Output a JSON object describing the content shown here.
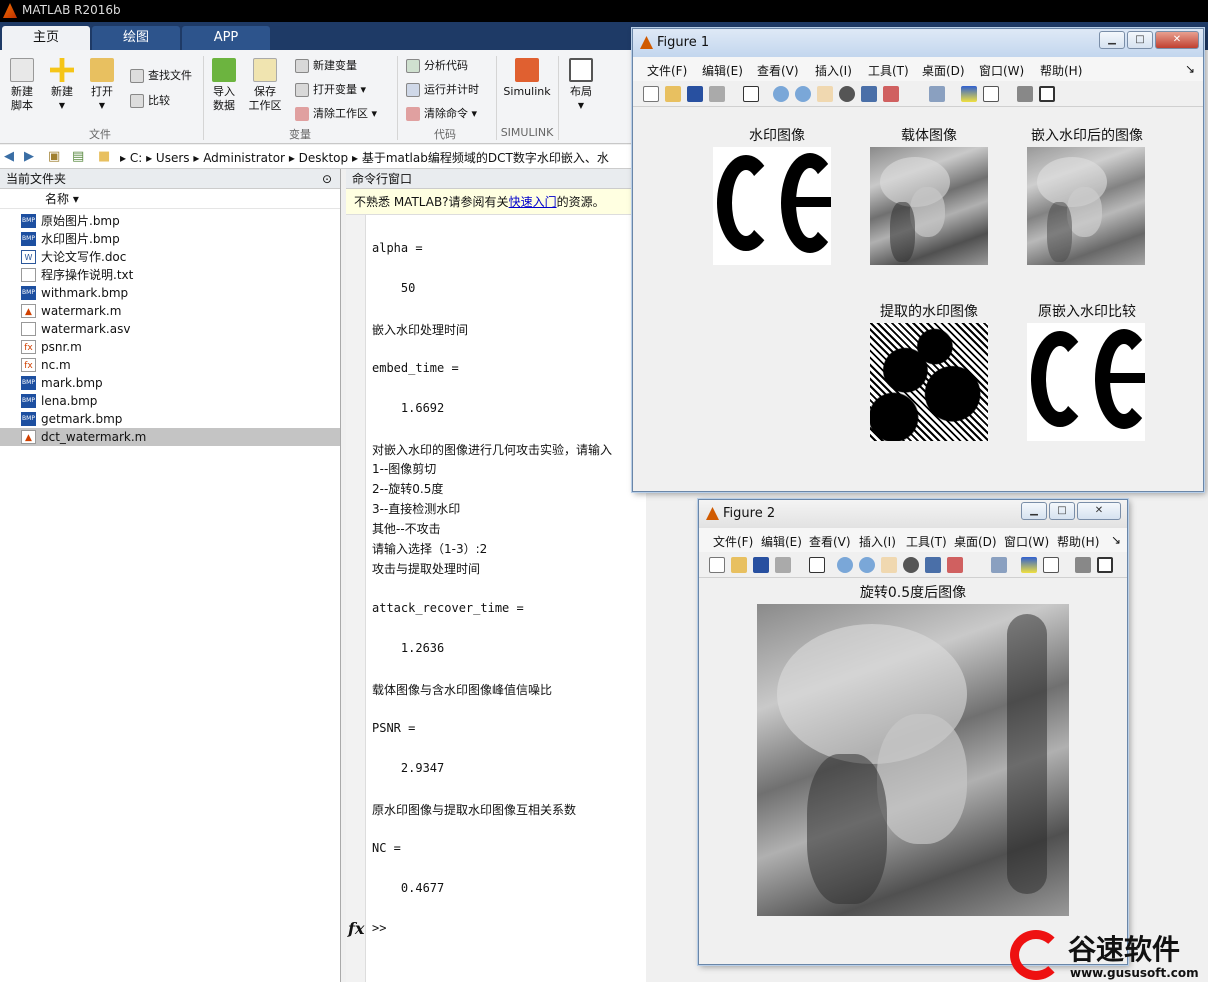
{
  "window": {
    "title": "MATLAB R2016b"
  },
  "tabs": [
    {
      "label": "主页"
    },
    {
      "label": "绘图"
    },
    {
      "label": "APP"
    }
  ],
  "ribbon": {
    "new_script": "新建\n脚本",
    "new": "新建",
    "open": "打开",
    "find_files": "查找文件",
    "compare": "比较",
    "import_data": "导入\n数据",
    "save_workspace": "保存\n工作区",
    "new_variable": "新建变量",
    "open_variable": "打开变量",
    "clear_workspace": "清除工作区",
    "analyze_code": "分析代码",
    "run_and_time": "运行并计时",
    "clear_commands": "清除命令",
    "simulink": "Simulink",
    "layout": "布局",
    "groups": {
      "file": "文件",
      "variable": "变量",
      "code": "代码",
      "simulink": "SIMULINK"
    }
  },
  "address": {
    "parts": [
      "C:",
      "Users",
      "Administrator",
      "Desktop",
      "基于matlab编程频域的DCT数字水印嵌入、水"
    ]
  },
  "file_panel": {
    "title": "当前文件夹",
    "column": "名称",
    "files": [
      {
        "name": "原始图片.bmp",
        "type": "bmp"
      },
      {
        "name": "水印图片.bmp",
        "type": "bmp"
      },
      {
        "name": "大论文写作.doc",
        "type": "doc"
      },
      {
        "name": "程序操作说明.txt",
        "type": "txt"
      },
      {
        "name": "withmark.bmp",
        "type": "bmp"
      },
      {
        "name": "watermark.m",
        "type": "m"
      },
      {
        "name": "watermark.asv",
        "type": "txt"
      },
      {
        "name": "psnr.m",
        "type": "m"
      },
      {
        "name": "nc.m",
        "type": "m"
      },
      {
        "name": "mark.bmp",
        "type": "bmp"
      },
      {
        "name": "lena.bmp",
        "type": "bmp"
      },
      {
        "name": "getmark.bmp",
        "type": "bmp"
      },
      {
        "name": "dct_watermark.m",
        "type": "m"
      }
    ]
  },
  "command_window": {
    "title": "命令行窗口",
    "tip_prefix": "不熟悉 MATLAB?请参阅有关",
    "tip_link": "快速入门",
    "tip_suffix": "的资源。",
    "lines": [
      {
        "text": "alpha =",
        "cn": false
      },
      {
        "text": "    50",
        "cn": false
      },
      {
        "text": "嵌入水印处理时间",
        "cn": true
      },
      {
        "text": "embed_time =",
        "cn": false
      },
      {
        "text": "    1.6692",
        "cn": false
      },
      {
        "text": "对嵌入水印的图像进行几何攻击实验，请输入",
        "cn": true
      },
      {
        "text": "1--图像剪切",
        "cn": true
      },
      {
        "text": "2--旋转0.5度",
        "cn": true
      },
      {
        "text": "3--直接检测水印",
        "cn": true
      },
      {
        "text": "其他--不攻击",
        "cn": true
      },
      {
        "text": "请输入选择（1-3）:2",
        "cn": true
      },
      {
        "text": "攻击与提取处理时间",
        "cn": true
      },
      {
        "text": "attack_recover_time =",
        "cn": false
      },
      {
        "text": "    1.2636",
        "cn": false
      },
      {
        "text": "载体图像与含水印图像峰值信噪比",
        "cn": true
      },
      {
        "text": "PSNR =",
        "cn": false
      },
      {
        "text": "    2.9347",
        "cn": false
      },
      {
        "text": "原水印图像与提取水印图像互相关系数",
        "cn": true
      },
      {
        "text": "NC =",
        "cn": false
      },
      {
        "text": "    0.4677",
        "cn": false
      }
    ],
    "fx": "fx",
    "prompt": ">>"
  },
  "figure1": {
    "title": "Figure 1",
    "menu": [
      "文件(F)",
      "编辑(E)",
      "查看(V)",
      "插入(I)",
      "工具(T)",
      "桌面(D)",
      "窗口(W)",
      "帮助(H)"
    ],
    "subplots": {
      "watermark": "水印图像",
      "carrier": "载体图像",
      "embedded": "嵌入水印后的图像",
      "extracted": "提取的水印图像",
      "original_compare": "原嵌入水印比较"
    }
  },
  "figure2": {
    "title": "Figure 2",
    "menu": [
      "文件(F)",
      "编辑(E)",
      "查看(V)",
      "插入(I)",
      "工具(T)",
      "桌面(D)",
      "窗口(W)",
      "帮助(H)"
    ],
    "plot_title": "旋转0.5度后图像"
  },
  "watermark_logo": {
    "brand": "谷速软件",
    "url": "www.gususoft.com"
  },
  "colors": {
    "tab_bar": "#1e3a66",
    "selected_row": "#c4c4c4",
    "logo_red": "#e11111"
  }
}
